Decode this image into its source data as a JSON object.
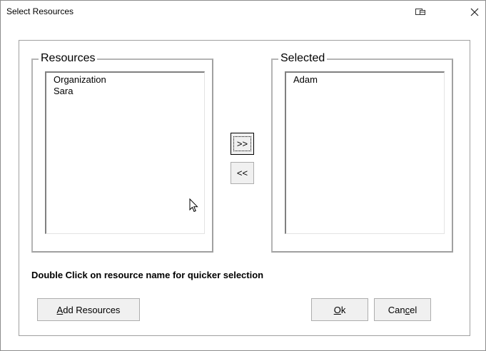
{
  "window": {
    "title": "Select Resources"
  },
  "resources": {
    "label": "Resources",
    "items": [
      "Organization",
      "Sara"
    ]
  },
  "selected": {
    "label": "Selected",
    "items": [
      "Adam"
    ]
  },
  "buttons": {
    "add_selected": ">>",
    "remove_selected": "<<",
    "add_resources": "Add Resources",
    "add_resources_mnemonic_rest": "dd Resources",
    "ok_mnemonic": "O",
    "ok_rest": "k",
    "cancel_pre": "Can",
    "cancel_mnemonic": "c",
    "cancel_post": "el"
  },
  "hint": "Double Click on resource name for quicker selection",
  "icons": {
    "title_icon": "window-switch-icon",
    "close": "close-icon",
    "cursor": "mouse-pointer-icon"
  }
}
